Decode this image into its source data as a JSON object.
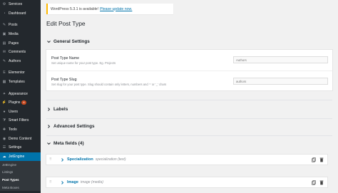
{
  "sidebar": {
    "items": [
      {
        "label": "Services",
        "icon": "services-icon"
      },
      {
        "label": "Dashboard",
        "icon": "dashboard-icon"
      },
      {
        "label": "Posts",
        "icon": "pin-icon"
      },
      {
        "label": "Media",
        "icon": "media-icon"
      },
      {
        "label": "Pages",
        "icon": "pages-icon"
      },
      {
        "label": "Comments",
        "icon": "comments-icon"
      },
      {
        "label": "Authors",
        "icon": "pin-icon"
      },
      {
        "label": "Elementor",
        "icon": "elementor-icon"
      },
      {
        "label": "Templates",
        "icon": "templates-icon"
      },
      {
        "label": "Appearance",
        "icon": "appearance-icon"
      },
      {
        "label": "Plugins",
        "icon": "plugins-icon",
        "badge": "4"
      },
      {
        "label": "Users",
        "icon": "users-icon"
      },
      {
        "label": "Smart Filters",
        "icon": "filter-icon"
      },
      {
        "label": "Tools",
        "icon": "tools-icon"
      },
      {
        "label": "Demo Content",
        "icon": "demo-icon"
      },
      {
        "label": "Settings",
        "icon": "settings-icon"
      },
      {
        "label": "JetEngine",
        "icon": "jetengine-icon"
      }
    ],
    "submenu": [
      "JetEngine",
      "Listings",
      "Post Types",
      "Meta Boxes"
    ],
    "submenu_current": "Post Types",
    "colors": {
      "bg": "#23282d",
      "active": "#0073aa",
      "badge": "#ca4a1f"
    }
  },
  "notice": {
    "text": "WordPress 5.3.1 is available!",
    "link": "Please update now."
  },
  "page": {
    "title": "Edit Post Type"
  },
  "general": {
    "heading": "General Settings",
    "name_label": "Post Type Name",
    "name_desc": "Set unique name for your post type. Eg. Projects",
    "name_value": "Authors",
    "slug_label": "Post Type Slug",
    "slug_desc": "Set slug for your post type. Slug should contain only letters, numbers and '-' or '_' chars",
    "slug_value": "authors"
  },
  "sections": {
    "labels": "Labels",
    "advanced": "Advanced Settings",
    "meta": "Meta fields (4)"
  },
  "meta_fields": [
    {
      "title": "Specialization",
      "type": "specialization (text)"
    },
    {
      "title": "Image",
      "type": "image (media)"
    }
  ]
}
